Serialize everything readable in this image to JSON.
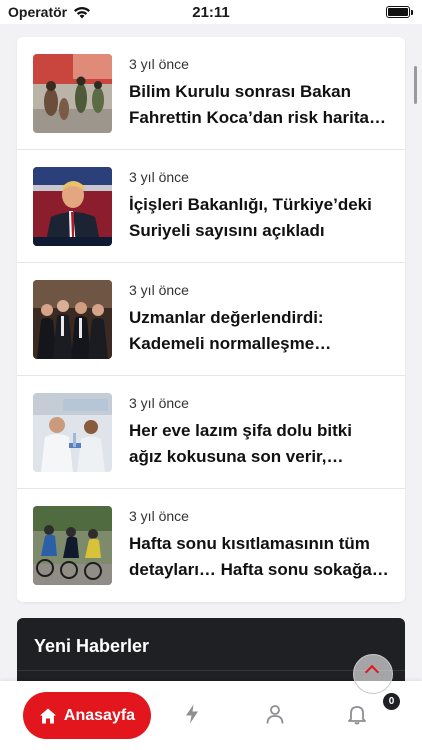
{
  "status_bar": {
    "carrier": "Operatör",
    "time": "21:11"
  },
  "news_list": [
    {
      "time": "3 yıl önce",
      "title": "Bilim Kurulu sonrası Bakan Fahrettin Koca’dan risk harita…",
      "image": "crowd-protest-image"
    },
    {
      "time": "3 yıl önce",
      "title": "İçişleri Bakanlığı, Türkiye’deki Suriyeli sayısını açıkladı",
      "image": "politician-speaking-image"
    },
    {
      "time": "3 yıl önce",
      "title": "Uzmanlar değerlendirdi: Kademeli normalleşme…",
      "image": "officials-group-image"
    },
    {
      "time": "3 yıl önce",
      "title": "Her eve lazım şifa dolu bitki ağız kokusuna son verir,…",
      "image": "laboratory-scientists-image"
    },
    {
      "time": "3 yıl önce",
      "title": "Hafta sonu kısıtlamasının tüm detayları… Hafta sonu sokağa…",
      "image": "cyclists-race-image"
    }
  ],
  "latest_news": {
    "title": "Yeni Haberler"
  },
  "bottom_nav": {
    "home_label": "Anasayfa",
    "notification_count": "0"
  },
  "colors": {
    "accent": "#e3161e",
    "dark": "#1f2023",
    "background": "#f2f2f4"
  }
}
